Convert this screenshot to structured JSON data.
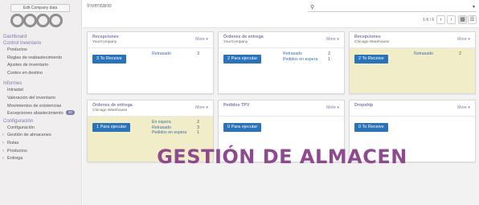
{
  "sidebar": {
    "company_button": "Edit Company data",
    "items": [
      {
        "type": "sec",
        "label": "Dashboard"
      },
      {
        "type": "sec",
        "label": "Control inventario"
      },
      {
        "type": "item",
        "label": "Productos"
      },
      {
        "type": "item",
        "label": "Reglas de reabastecimiento"
      },
      {
        "type": "item",
        "label": "Ajustes de inventario"
      },
      {
        "type": "item",
        "label": "Costes en destino"
      },
      {
        "type": "gap"
      },
      {
        "type": "sec",
        "label": "Informes"
      },
      {
        "type": "item",
        "label": "Intrastat"
      },
      {
        "type": "item",
        "label": "Valoración del inventario"
      },
      {
        "type": "item",
        "label": "Movimientos de existencias"
      },
      {
        "type": "item",
        "label": "Excepciones abastecimiento",
        "badge": "10"
      },
      {
        "type": "sec",
        "label": "Configuración"
      },
      {
        "type": "item",
        "label": "Configuración"
      },
      {
        "type": "caret",
        "label": "Gestión de almacenes"
      },
      {
        "type": "caret",
        "label": "Rutas"
      },
      {
        "type": "caret",
        "label": "Productos"
      },
      {
        "type": "caret",
        "label": "Entrega"
      }
    ]
  },
  "header": {
    "breadcrumb": "Inventario",
    "search_icon": "search-icon",
    "search_dropdown_icon": "caret-down-icon",
    "pager": "1-6 / 6",
    "prev": "‹",
    "next": "›",
    "kanban_icon": "grid-icon",
    "list_icon": "list-icon"
  },
  "cards": [
    {
      "title": "Recepciones",
      "subtitle": "YourCompany",
      "more": "More ▾",
      "button": "3 To Receive",
      "warn": false,
      "stats": [
        {
          "label": "Retrasado",
          "value": "3"
        }
      ]
    },
    {
      "title": "Órdenes de entrega",
      "subtitle": "YourCompany",
      "more": "More ▾",
      "button": "2 Para ejecutar",
      "warn": false,
      "stats": [
        {
          "label": "Retrasado",
          "value": "2"
        },
        {
          "label": "Pedidos en espera",
          "value": "1"
        }
      ]
    },
    {
      "title": "Recepciones",
      "subtitle": "Chicago Warehouse",
      "more": "More ▾",
      "button": "2 To Receive",
      "warn": true,
      "stats": [
        {
          "label": "Retrasado",
          "value": "2"
        }
      ]
    },
    {
      "title": "Órdenes de entrega",
      "subtitle": "Chicago Warehouse",
      "more": "More ▾",
      "button": "1 Para ejecutar",
      "warn": true,
      "stats": [
        {
          "label": "En espera",
          "value": "2"
        },
        {
          "label": "Retrasado",
          "value": "3"
        },
        {
          "label": "Pedidos en espera",
          "value": "1"
        }
      ]
    },
    {
      "title": "Pedidos TPV",
      "subtitle": "",
      "more": "More ▾",
      "button": "0 Para ejecutar",
      "warn": false,
      "stats": []
    },
    {
      "title": "Dropship",
      "subtitle": "",
      "more": "More ▾",
      "button": "0 To Receive",
      "warn": false,
      "stats": []
    }
  ],
  "overlay_title": "GESTIÓN DE ALMACEN",
  "colors": {
    "accent": "#7c7bad",
    "button": "#2b73b9",
    "warning_bg": "#f1edc9",
    "overlay": "#8f4a8f"
  }
}
